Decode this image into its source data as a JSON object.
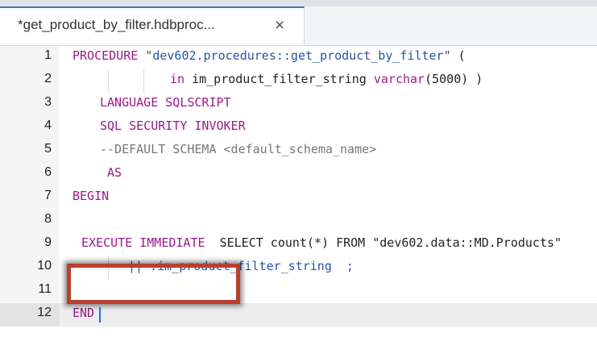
{
  "tab": {
    "label": "*get_product_by_filter.hdbproc...",
    "close": "×"
  },
  "colors": {
    "keyword": "#9a1a8c",
    "string": "#2a52a0",
    "comment": "#777777",
    "annotation_box": "#b8402d",
    "tab_accent": "#3a78b7"
  },
  "editor": {
    "current_line": 12,
    "lines": [
      {
        "num": "1"
      },
      {
        "num": "2"
      },
      {
        "num": "3"
      },
      {
        "num": "4"
      },
      {
        "num": "5"
      },
      {
        "num": "6"
      },
      {
        "num": "7"
      },
      {
        "num": "8"
      },
      {
        "num": "9"
      },
      {
        "num": "10"
      },
      {
        "num": "11"
      },
      {
        "num": "12"
      }
    ],
    "tokens": {
      "l1_kw": "PROCEDURE",
      "l1_str": "\"dev602.procedures::get_product_by_filter\"",
      "l1_paren": "(",
      "l2_kw1": "in",
      "l2_name": "im_product_filter_string",
      "l2_kw2": "varchar",
      "l2_rest": "(5000) )",
      "l3_kw": "LANGUAGE SQLSCRIPT",
      "l4_kw": "SQL SECURITY INVOKER",
      "l5_cmt": "--DEFAULT SCHEMA <default_schema_name>",
      "l6_kw": "AS",
      "l7_kw": "BEGIN",
      "l9_kw": "EXECUTE IMMEDIATE",
      "l9_rest": "SELECT count(*) FROM \"dev602.data::MD.Products\"",
      "l10_op": "||",
      "l10_rest": ":im_product_filter_string  ;",
      "l12_kw": "END"
    }
  }
}
